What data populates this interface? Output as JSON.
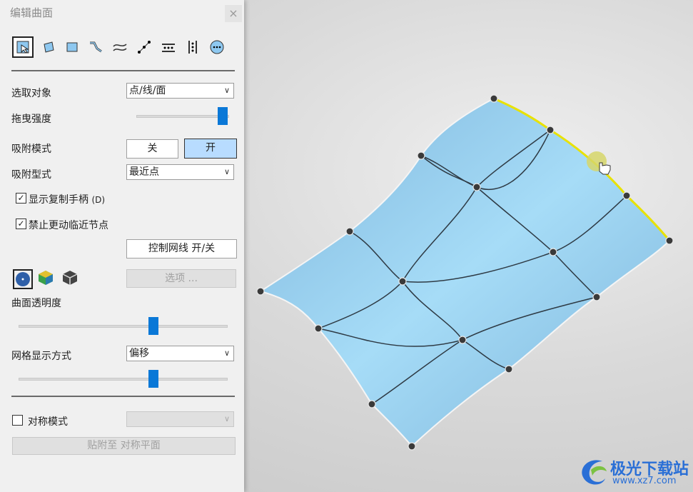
{
  "panel": {
    "title": "编辑曲面",
    "close_glyph": "×",
    "tools": [
      "select-tool-icon",
      "quad-patch-icon",
      "rect-patch-icon",
      "curve-edit-icon",
      "wave-icon",
      "line-nodes-icon",
      "row-distribute-icon",
      "column-distribute-icon",
      "options-circle-icon"
    ],
    "select_object": {
      "label": "选取对象",
      "value": "点/线/面"
    },
    "drag_strength": {
      "label": "拖曳强度",
      "value": 1.0
    },
    "snap_mode": {
      "label": "吸附模式",
      "off": "关",
      "on": "开",
      "active": "on"
    },
    "snap_type": {
      "label": "吸附型式",
      "value": "最近点"
    },
    "show_copy_handles": {
      "label": "显示复制手柄",
      "shortcut": "(D)",
      "checked": true
    },
    "no_move_neighbors": {
      "label": "禁止更动临近节点",
      "checked": true
    },
    "control_mesh_button": "控制网线 开/关",
    "options_button": "选项 ...",
    "transparency": {
      "label": "曲面透明度",
      "value": 0.6
    },
    "mesh_display": {
      "label": "网格显示方式",
      "value": "偏移",
      "slider": 0.6
    },
    "symmetry": {
      "label": "对称模式",
      "checked": false,
      "value": ""
    },
    "snap_to_sym_button": "贴附至 对称平面"
  },
  "viewport": {
    "surface_color": "#93c8ea",
    "highlight_edge_color": "#e8e200"
  },
  "watermark": {
    "name": "极光下载站",
    "url": "www.xz7.com"
  }
}
